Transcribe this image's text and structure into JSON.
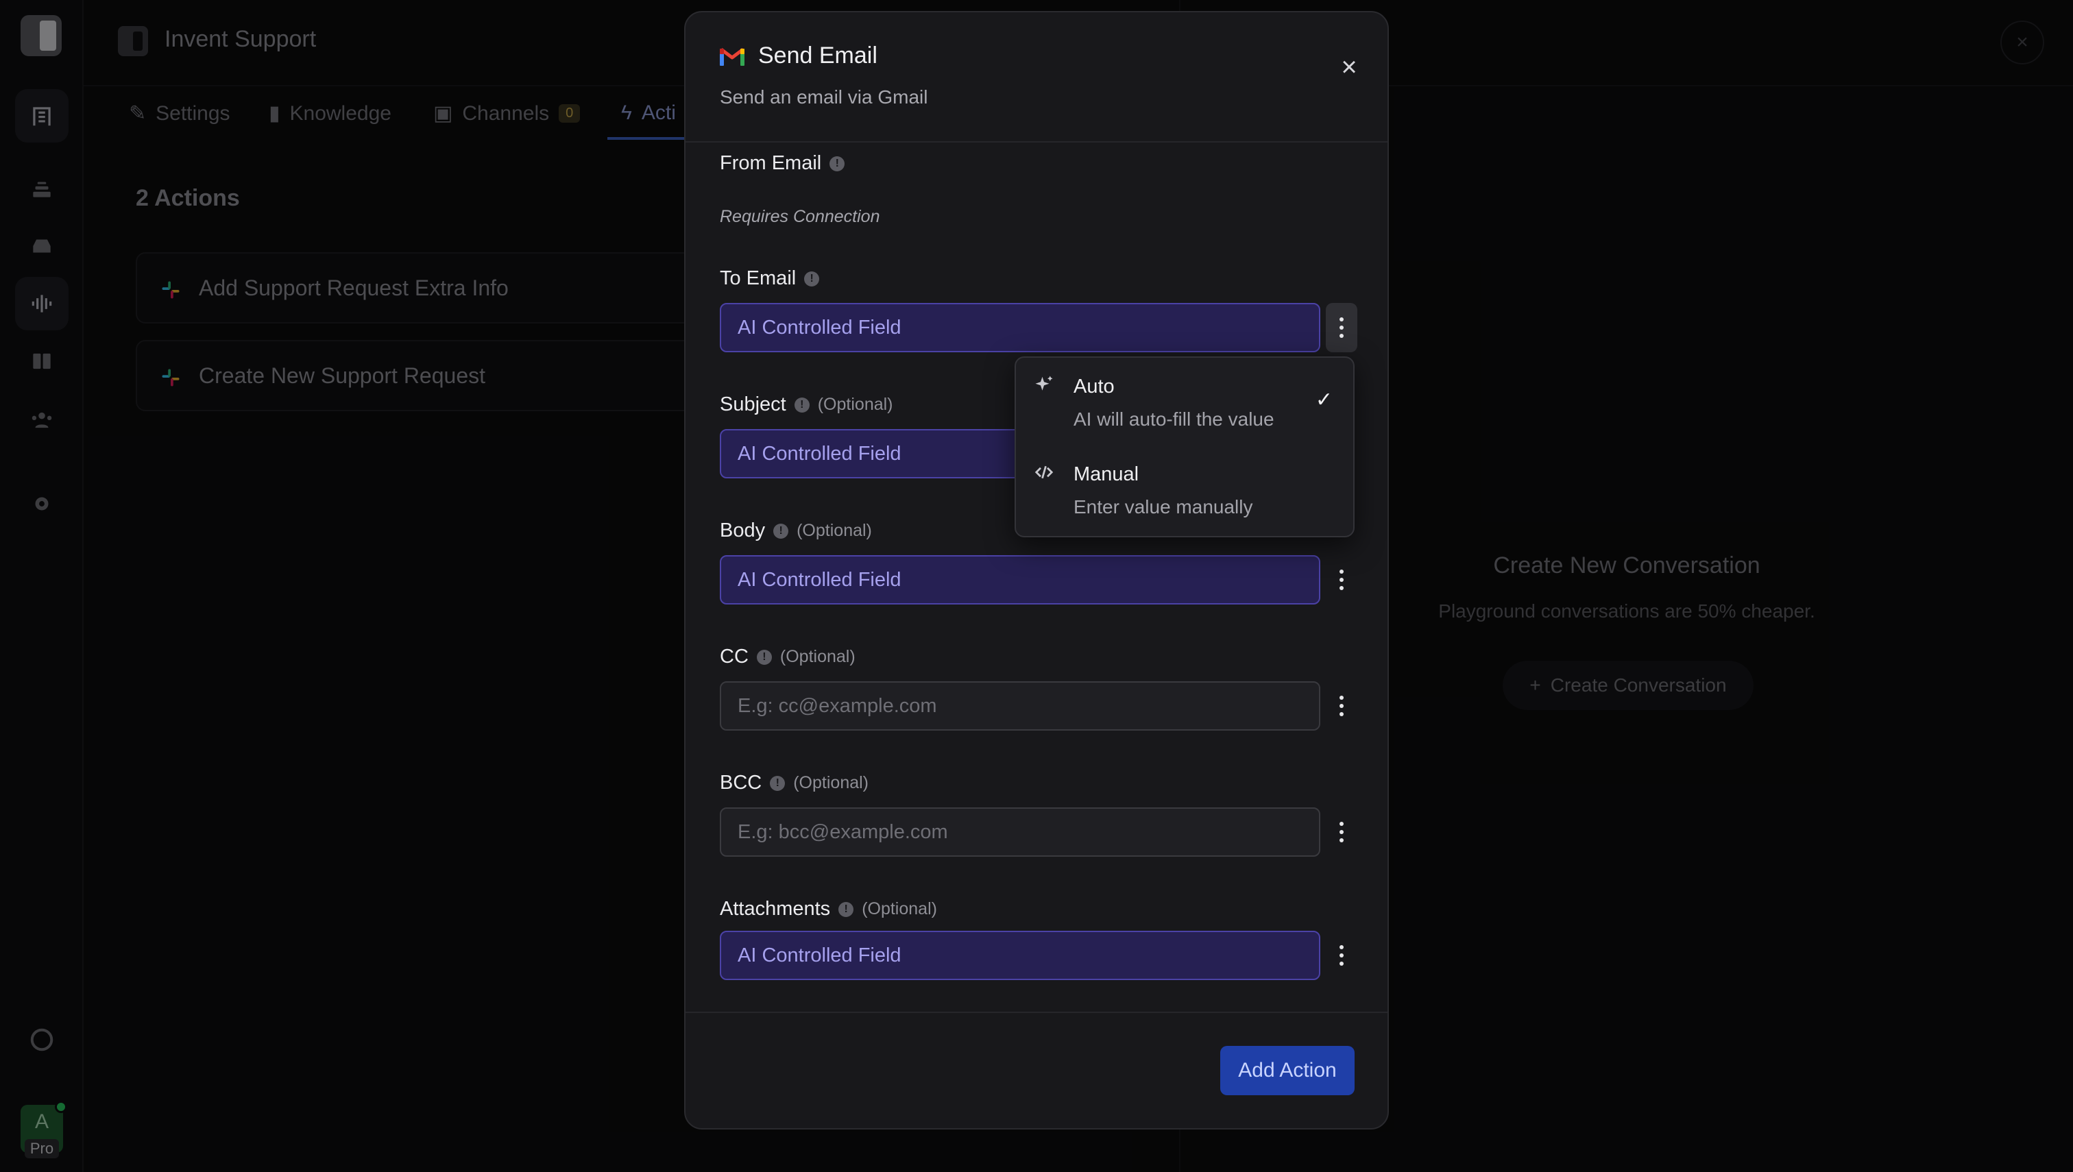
{
  "app": {
    "workspace_title": "Invent Support",
    "avatar_letter": "A",
    "avatar_badge": "Pro"
  },
  "tabs": [
    {
      "label": "Settings"
    },
    {
      "label": "Knowledge"
    },
    {
      "label": "Channels",
      "badge": "0"
    },
    {
      "label": "Acti"
    }
  ],
  "actions": {
    "count_title": "2 Actions",
    "items": [
      {
        "label": "Add Support Request Extra Info"
      },
      {
        "label": "Create New Support Request"
      }
    ]
  },
  "playground": {
    "title": "Create New Conversation",
    "subtitle": "Playground conversations are 50% cheaper.",
    "button_label": "Create Conversation"
  },
  "modal": {
    "title": "Send Email",
    "subtitle": "Send an email via Gmail",
    "from_email": {
      "label": "From Email",
      "note": "Requires Connection"
    },
    "optional_text": "(Optional)",
    "fields": [
      {
        "label": "To Email",
        "optional": false,
        "value": "AI Controlled Field",
        "placeholder": ""
      },
      {
        "label": "Subject",
        "optional": true,
        "value": "AI Controlled Field",
        "placeholder": ""
      },
      {
        "label": "Body",
        "optional": true,
        "value": "AI Controlled Field",
        "placeholder": ""
      },
      {
        "label": "CC",
        "optional": true,
        "value": "",
        "placeholder": "E.g: cc@example.com"
      },
      {
        "label": "BCC",
        "optional": true,
        "value": "",
        "placeholder": "E.g: bcc@example.com"
      },
      {
        "label": "Attachments",
        "optional": true,
        "value": "AI Controlled Field",
        "placeholder": ""
      }
    ],
    "submit_label": "Add Action"
  },
  "dropdown": {
    "options": [
      {
        "title": "Auto",
        "description": "AI will auto-fill the value",
        "selected": true,
        "icon": "sparkles-icon"
      },
      {
        "title": "Manual",
        "description": "Enter value manually",
        "selected": false,
        "icon": "code-icon"
      }
    ],
    "check_glyph": "✓"
  },
  "colors": {
    "accent_blue": "#1f3fa8",
    "ai_field_bg": "#262053",
    "ai_field_border": "#4b42a6"
  }
}
